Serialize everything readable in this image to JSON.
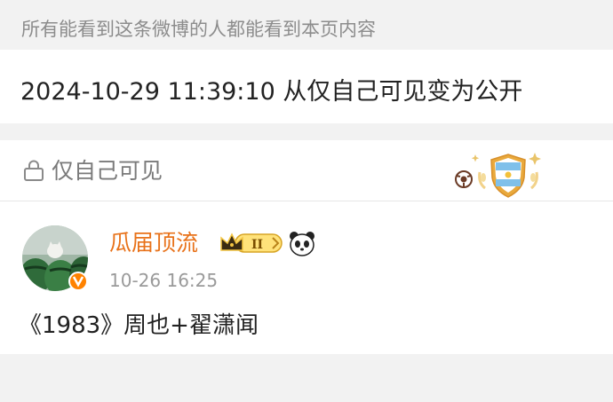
{
  "notice": {
    "text": "所有能看到这条微博的人都能看到本页内容"
  },
  "change_log": {
    "text": "2024-10-29 11:39:10 从仅自己可见变为公开"
  },
  "visibility": {
    "icon": "lock-icon",
    "label": "仅自己可见"
  },
  "post": {
    "username": "瓜届顶流",
    "time": "10-26 16:25",
    "body": "《1983》周也+翟潇闻",
    "badge_text": "II",
    "username_color": "#e8721a"
  }
}
